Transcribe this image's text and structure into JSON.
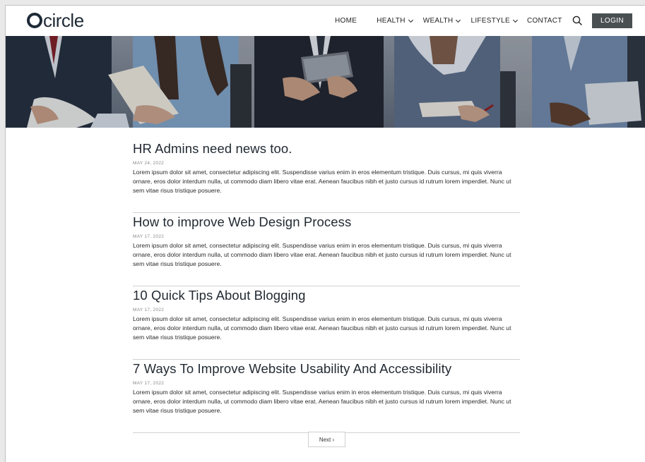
{
  "brand": {
    "logo_text": "circle"
  },
  "nav": {
    "items": [
      {
        "label": "HOME",
        "dropdown": false
      },
      {
        "label": "HEALTH",
        "dropdown": true
      },
      {
        "label": "WEALTH",
        "dropdown": true
      },
      {
        "label": "LIFESTYLE",
        "dropdown": true
      },
      {
        "label": "CONTACT",
        "dropdown": false
      }
    ],
    "search_icon": "search-icon",
    "login_label": "LOGIN"
  },
  "posts": [
    {
      "title": "HR Admins need news too.",
      "date": "MAY 24, 2022",
      "body": "Lorem ipsum dolor sit amet, consectetur adipiscing elit. Suspendisse varius enim in eros elementum tristique. Duis cursus, mi quis viverra ornare, eros dolor interdum nulla, ut commodo diam libero vitae erat. Aenean faucibus nibh et justo cursus id rutrum lorem imperdiet. Nunc ut sem vitae risus tristique posuere."
    },
    {
      "title": "How to improve Web Design Process",
      "date": "MAY 17, 2022",
      "body": "Lorem ipsum dolor sit amet, consectetur adipiscing elit. Suspendisse varius enim in eros elementum tristique. Duis cursus, mi quis viverra ornare, eros dolor interdum nulla, ut commodo diam libero vitae erat. Aenean faucibus nibh et justo cursus id rutrum lorem imperdiet. Nunc ut sem vitae risus tristique posuere."
    },
    {
      "title": "10 Quick Tips About Blogging",
      "date": "MAY 17, 2022",
      "body": "Lorem ipsum dolor sit amet, consectetur adipiscing elit. Suspendisse varius enim in eros elementum tristique. Duis cursus, mi quis viverra ornare, eros dolor interdum nulla, ut commodo diam libero vitae erat. Aenean faucibus nibh et justo cursus id rutrum lorem imperdiet. Nunc ut sem vitae risus tristique posuere."
    },
    {
      "title": "7 Ways To Improve Website Usability And Accessibility",
      "date": "MAY 17, 2022",
      "body": "Lorem ipsum dolor sit amet, consectetur adipiscing elit. Suspendisse varius enim in eros elementum tristique. Duis cursus, mi quis viverra ornare, eros dolor interdum nulla, ut commodo diam libero vitae erat. Aenean faucibus nibh et justo cursus id rutrum lorem imperdiet. Nunc ut sem vitae risus tristique posuere."
    }
  ],
  "pagination": {
    "next_label": "Next ›"
  },
  "colors": {
    "brand_dark": "#1e2a36",
    "login_bg": "#4a4f52",
    "divider": "#d2d2d2"
  }
}
